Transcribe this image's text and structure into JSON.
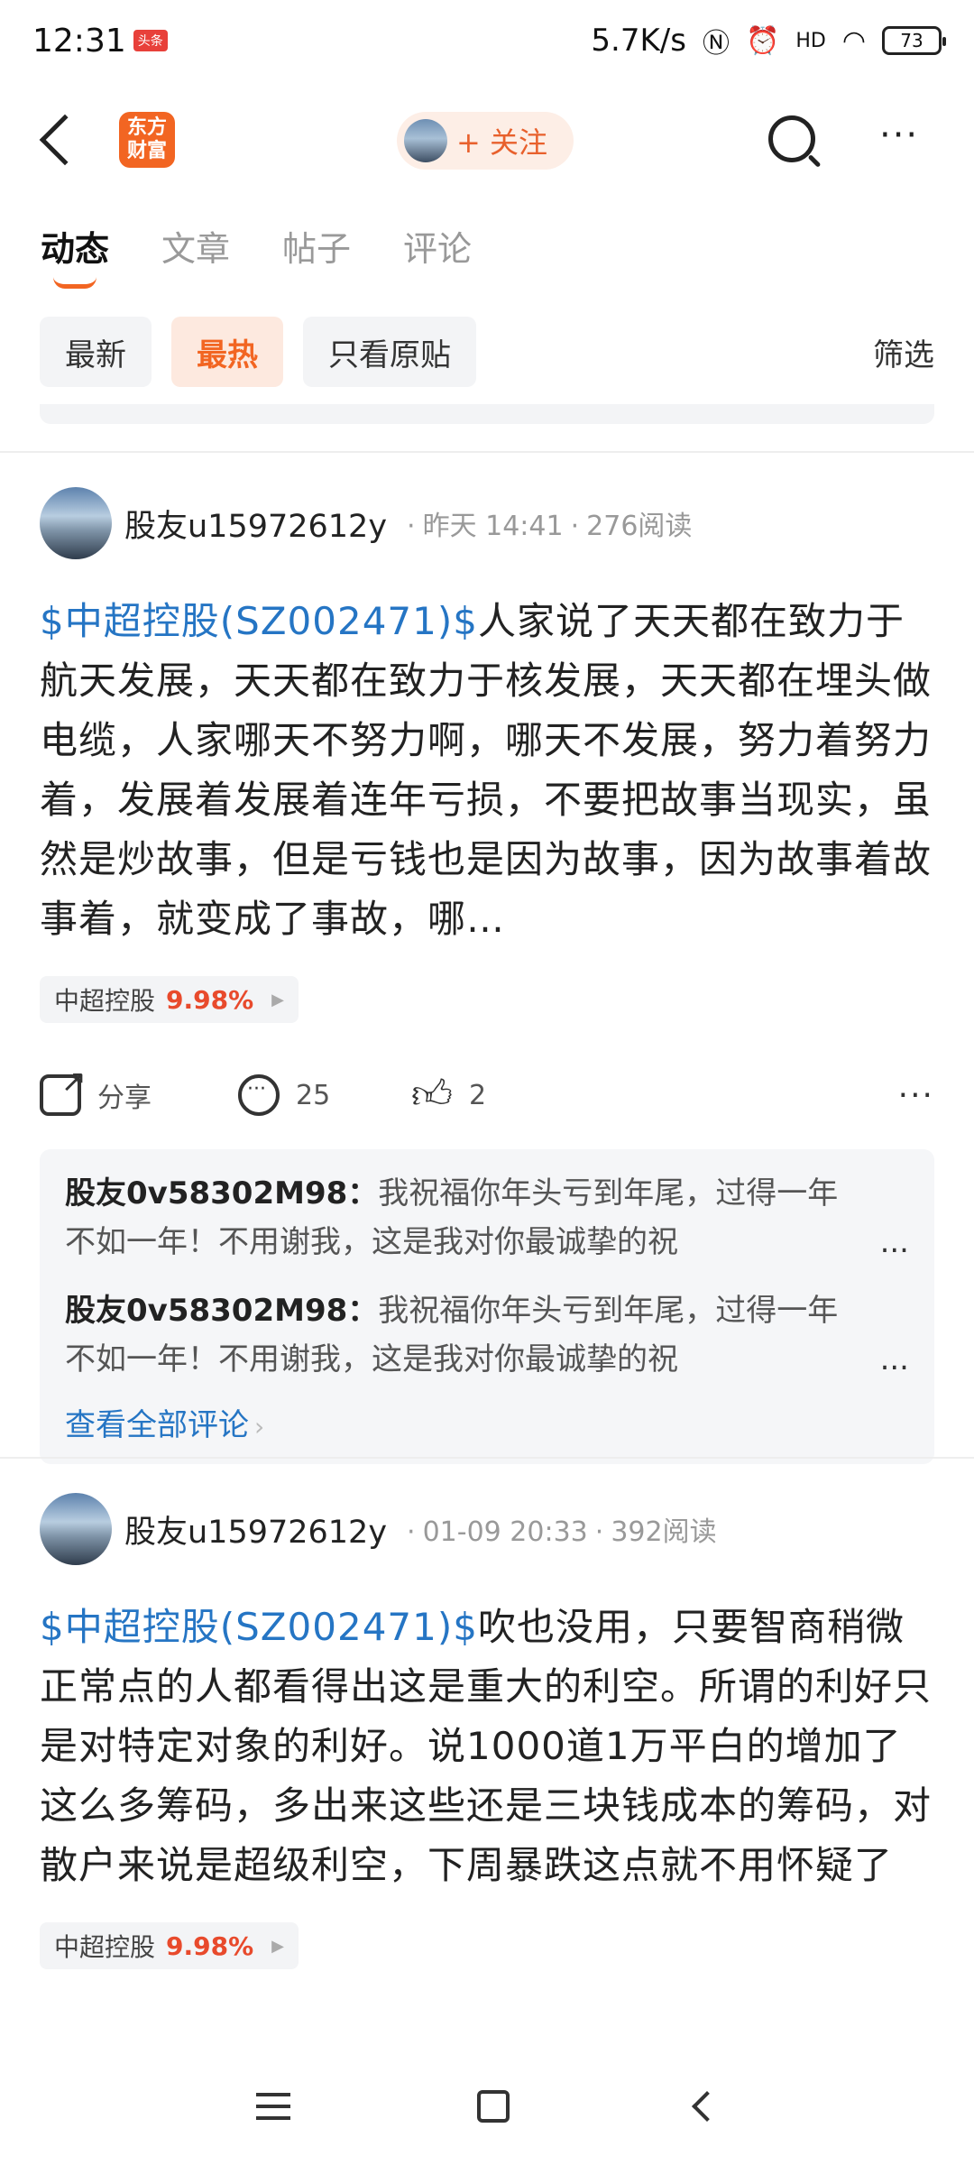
{
  "status_bar": {
    "time": "12:31",
    "badge": "头条",
    "speed": "5.7K/s",
    "network": "HD",
    "battery": "73"
  },
  "header": {
    "logo_text": "东方\n财富",
    "follow_label": "+ 关注"
  },
  "tabs": [
    "动态",
    "文章",
    "帖子",
    "评论"
  ],
  "filters": {
    "chips": [
      "最新",
      "最热",
      "只看原贴"
    ],
    "filter_label": "筛选"
  },
  "posts": [
    {
      "author": "股友u15972612y",
      "time": "昨天 14:41",
      "reads": "276阅读",
      "stock_link": "$中超控股(SZ002471)$",
      "body": "人家说了天天都在致力于航天发展，天天都在致力于核发展，天天都在埋头做电缆，人家哪天不努力啊，哪天不发展，努力着努力着，发展着发展着连年亏损，不要把故事当现实，虽然是炒故事，但是亏钱也是因为故事，因为故事着故事着，就变成了事故，哪…",
      "stock_name": "中超控股",
      "stock_change": "9.98%",
      "share_label": "分享",
      "comment_count": "25",
      "like_count": "2",
      "comments": [
        {
          "author": "股友0v58302M98：",
          "text": "我祝福你年头亏到年尾，过得一年不如一年！不用谢我，这是我对你最诚挚的祝",
          "ellipsis": "..."
        },
        {
          "author": "股友0v58302M98：",
          "text": "我祝福你年头亏到年尾，过得一年不如一年！不用谢我，这是我对你最诚挚的祝",
          "ellipsis": "..."
        }
      ],
      "view_all": "查看全部评论"
    },
    {
      "author": "股友u15972612y",
      "time": "01-09 20:33",
      "reads": "392阅读",
      "stock_link": "$中超控股(SZ002471)$",
      "body": "吹也没用，只要智商稍微正常点的人都看得出这是重大的利空。所谓的利好只是对特定对象的利好。说1000道1万平白的增加了这么多筹码，多出来这些还是三块钱成本的筹码，对散户来说是超级利空，下周暴跌这点就不用怀疑了",
      "stock_name": "中超控股",
      "stock_change": "9.98%"
    }
  ],
  "colors": {
    "brand": "#f26522",
    "link": "#2575c4",
    "up": "#e84a2c"
  }
}
